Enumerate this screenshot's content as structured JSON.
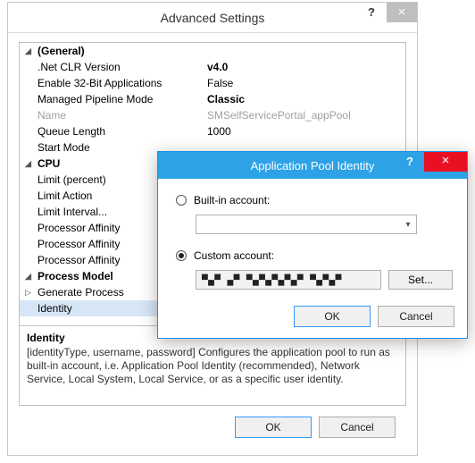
{
  "adv": {
    "title": "Advanced Settings",
    "categories": {
      "general": "(General)",
      "cpu": "CPU",
      "process_model": "Process Model"
    },
    "rows": {
      "net_clr": {
        "label": ".Net CLR Version",
        "value": "v4.0"
      },
      "enable32": {
        "label": "Enable 32-Bit Applications",
        "value": "False"
      },
      "pipeline": {
        "label": "Managed Pipeline Mode",
        "value": "Classic"
      },
      "name": {
        "label": "Name",
        "value": "SMSelfServicePortal_appPool"
      },
      "queue_length": {
        "label": "Queue Length",
        "value": "1000"
      },
      "start_mode": {
        "label": "Start Mode",
        "value": ""
      },
      "limit_percent": {
        "label": "Limit (percent)",
        "value": ""
      },
      "limit_action": {
        "label": "Limit Action",
        "value": ""
      },
      "limit_interval": {
        "label": "Limit Interval...",
        "value": ""
      },
      "proc_affinity_1": {
        "label": "Processor Affinity",
        "value": ""
      },
      "proc_affinity_2": {
        "label": "Processor Affinity",
        "value": ""
      },
      "proc_affinity_3": {
        "label": "Processor Affinity",
        "value": ""
      },
      "generate_process": {
        "label": "Generate Process",
        "value": ""
      },
      "identity": {
        "label": "Identity",
        "value": ""
      }
    },
    "description": {
      "title": "Identity",
      "text": "[identityType, username, password] Configures the application pool to run as built-in account, i.e. Application Pool Identity (recommended), Network Service, Local System, Local Service, or as a specific user identity."
    },
    "buttons": {
      "ok": "OK",
      "cancel": "Cancel"
    }
  },
  "dialog": {
    "title": "Application Pool Identity",
    "builtin_label": "Built-in account:",
    "custom_label": "Custom account:",
    "builtin_selected": false,
    "custom_selected": true,
    "selected_builtin": "",
    "custom_account_masked": "▀▄▀ ▄▀  ▀▄▀▄▀▄▀▄▀ ▀▄▀▄▀",
    "set_label": "Set...",
    "ok": "OK",
    "cancel": "Cancel"
  }
}
